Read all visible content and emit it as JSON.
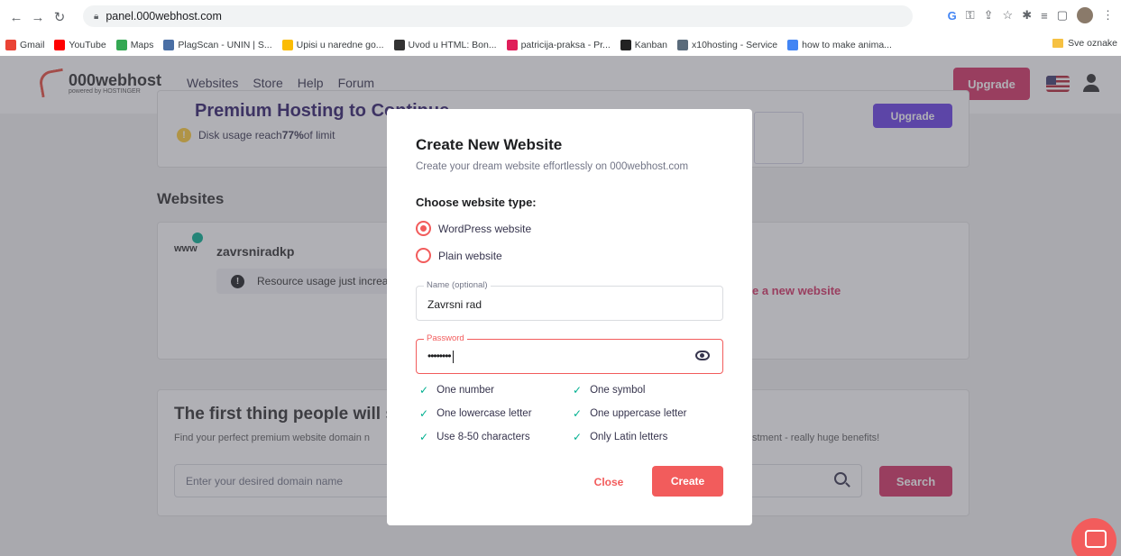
{
  "browser": {
    "url": "panel.000webhost.com",
    "bookmarks": [
      {
        "label": "Gmail",
        "color": "#ea4335"
      },
      {
        "label": "YouTube",
        "color": "#ff0000"
      },
      {
        "label": "Maps",
        "color": "#34a853"
      },
      {
        "label": "PlagScan - UNIN | S...",
        "color": "#4a6fa5"
      },
      {
        "label": "Upisi u naredne go...",
        "color": "#fbbc04"
      },
      {
        "label": "Uvod u HTML: Bon...",
        "color": "#333333"
      },
      {
        "label": "patricija-praksa - Pr...",
        "color": "#e01e5a"
      },
      {
        "label": "Kanban",
        "color": "#222222"
      },
      {
        "label": "x10hosting - Service",
        "color": "#5a6b7b"
      },
      {
        "label": "how to make anima...",
        "color": "#4285f4"
      }
    ],
    "other_bookmarks": "Sve oznake"
  },
  "header": {
    "logo_name": "000webhost",
    "logo_sub": "powered by HOSTINGER",
    "nav": [
      "Websites",
      "Store",
      "Help",
      "Forum"
    ],
    "upgrade": "Upgrade"
  },
  "background": {
    "premium_title": "Premium Hosting to Continue",
    "disk_prefix": "Disk usage reach ",
    "disk_percent": "77%",
    "disk_suffix": " of limit",
    "card_upgrade": "Upgrade",
    "websites_heading": "Websites",
    "www": "www",
    "site_name": "zavrsniradkp",
    "resource_msg": "Resource usage just increased",
    "create_link": "e a new website",
    "first_thing": "The first thing people will see",
    "find_text": "Find your perfect premium website domain n",
    "invest_text": "stment - really huge benefits!",
    "domain_placeholder": "Enter your desired domain name",
    "search": "Search"
  },
  "modal": {
    "title": "Create New Website",
    "subtitle": "Create your dream website effortlessly on 000webhost.com",
    "choose": "Choose website type:",
    "options": [
      {
        "label": "WordPress website",
        "selected": true
      },
      {
        "label": "Plain website",
        "selected": false
      }
    ],
    "name_label": "Name (optional)",
    "name_value": "Zavrsni rad",
    "password_label": "Password",
    "password_value": "••••••••",
    "rules": [
      "One number",
      "One symbol",
      "One lowercase letter",
      "One uppercase letter",
      "Use 8-50 characters",
      "Only Latin letters"
    ],
    "close": "Close",
    "create": "Create"
  },
  "colors": {
    "accent": "#f25c5c",
    "brand_red": "#d63163",
    "purple": "#673de6",
    "success": "#00b090"
  }
}
